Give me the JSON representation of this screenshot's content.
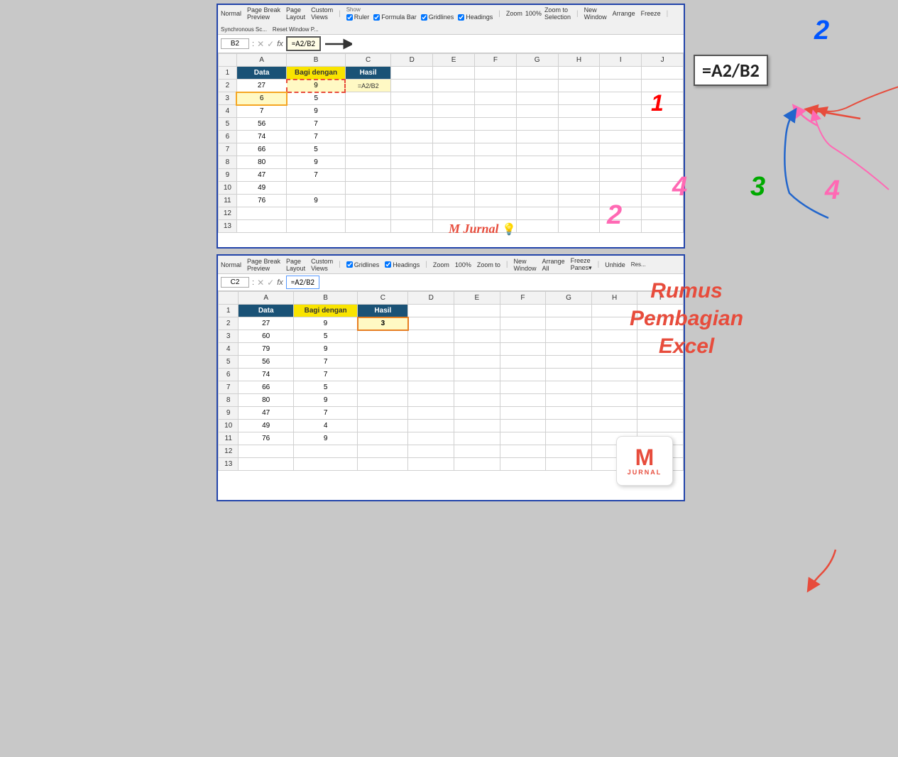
{
  "panels": {
    "top": {
      "ribbon": {
        "items": [
          "Normal",
          "Page Break Preview",
          "Page Layout",
          "Custom Views"
        ],
        "show_items": [
          "Ruler",
          "Formula Bar",
          "Gridlines",
          "Headings"
        ],
        "zoom_label": "Zoom",
        "zoom_value": "100%",
        "zoom_to": "Zoom to Selection",
        "new_window": "New Window",
        "arrange": "Arrange",
        "freeze": "Freeze",
        "reset_window": "Reset Window P..."
      },
      "cell_ref": "B2",
      "formula": "=A2/B2",
      "spreadsheet": {
        "headers": [
          "A",
          "B",
          "C",
          "D",
          "E",
          "F",
          "G",
          "H",
          "I",
          "J"
        ],
        "col1_header": "Data",
        "col2_header": "Bagi dengan",
        "col3_header": "Hasil",
        "rows": [
          {
            "row": 2,
            "a": "27",
            "b": "9",
            "c": "=A2/B2"
          },
          {
            "row": 3,
            "a": "6",
            "b": "5",
            "c": ""
          },
          {
            "row": 4,
            "a": "7",
            "b": "9",
            "c": ""
          },
          {
            "row": 5,
            "a": "56",
            "b": "7",
            "c": ""
          },
          {
            "row": 6,
            "a": "74",
            "b": "7",
            "c": ""
          },
          {
            "row": 7,
            "a": "66",
            "b": "5",
            "c": ""
          },
          {
            "row": 8,
            "a": "80",
            "b": "9",
            "c": ""
          },
          {
            "row": 9,
            "a": "47",
            "b": "7",
            "c": ""
          },
          {
            "row": 10,
            "a": "49",
            "b": "",
            "c": ""
          },
          {
            "row": 11,
            "a": "76",
            "b": "9",
            "c": ""
          },
          {
            "row": 12,
            "a": "",
            "b": "",
            "c": ""
          },
          {
            "row": 13,
            "a": "",
            "b": "",
            "c": ""
          }
        ]
      },
      "formula_popup": "=A2/B2",
      "num1": "1",
      "num2_blue": "2",
      "num2_pink": "2",
      "num3": "3",
      "num4_left": "4",
      "num4_right": "4",
      "m_jurnal": "M Jurnal"
    },
    "bottom": {
      "ribbon": {
        "items": [
          "Normal",
          "Page Break Preview",
          "Page Layout",
          "Custom Views"
        ],
        "show_items": [
          "Gridlines",
          "Headings"
        ],
        "zoom_label": "Zoom",
        "zoom_value": "100%",
        "zoom_to": "Zoom to",
        "new_window": "New Window",
        "arrange": "Arrange",
        "freeze": "Freeze",
        "unhide": "Unhide",
        "reset": "Res..."
      },
      "cell_ref": "C2",
      "formula": "=A2/B2",
      "spreadsheet": {
        "headers": [
          "A",
          "B",
          "C",
          "D",
          "E",
          "F",
          "G",
          "H",
          "I"
        ],
        "col1_header": "Data",
        "col2_header": "Bagi dengan",
        "col3_header": "Hasil",
        "rows": [
          {
            "row": 2,
            "a": "27",
            "b": "9",
            "c": "3"
          },
          {
            "row": 3,
            "a": "60",
            "b": "5",
            "c": ""
          },
          {
            "row": 4,
            "a": "79",
            "b": "9",
            "c": ""
          },
          {
            "row": 5,
            "a": "56",
            "b": "7",
            "c": ""
          },
          {
            "row": 6,
            "a": "74",
            "b": "7",
            "c": ""
          },
          {
            "row": 7,
            "a": "66",
            "b": "5",
            "c": ""
          },
          {
            "row": 8,
            "a": "80",
            "b": "9",
            "c": ""
          },
          {
            "row": 9,
            "a": "47",
            "b": "7",
            "c": ""
          },
          {
            "row": 10,
            "a": "49",
            "b": "4",
            "c": ""
          },
          {
            "row": 11,
            "a": "76",
            "b": "9",
            "c": ""
          },
          {
            "row": 12,
            "a": "",
            "b": "",
            "c": ""
          },
          {
            "row": 13,
            "a": "",
            "b": "",
            "c": ""
          }
        ]
      },
      "rumus_lines": [
        "Rumus",
        "Pembagian",
        "Excel"
      ],
      "m_logo": "M",
      "m_logo_sub": "JURNAL"
    }
  }
}
